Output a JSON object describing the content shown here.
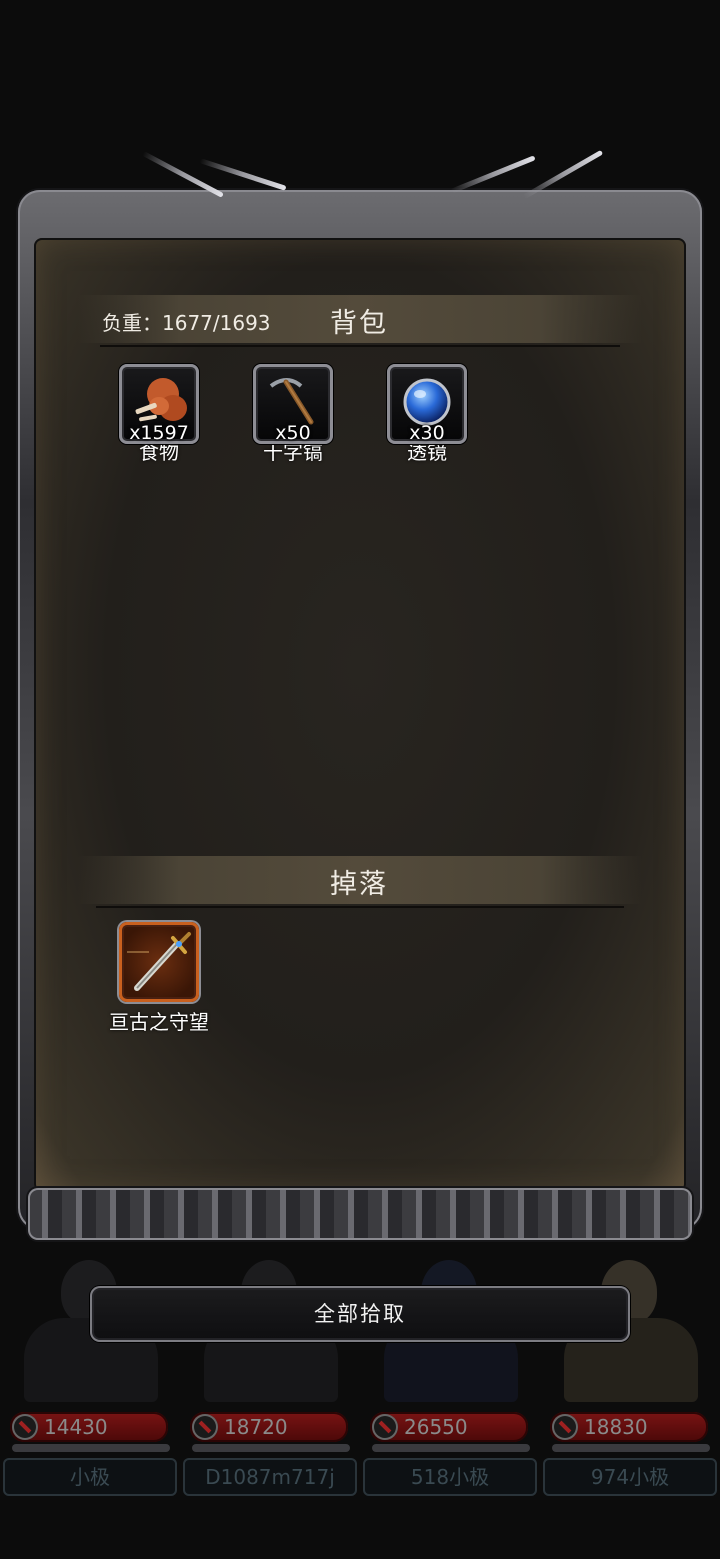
{
  "inventory": {
    "weight_label": "负重：1677/1693",
    "title": "背包",
    "items": [
      {
        "name": "食物",
        "qty": "x1597",
        "icon": "food-icon"
      },
      {
        "name": "十字镐",
        "qty": "x50",
        "icon": "pickaxe-icon"
      },
      {
        "name": "透镜",
        "qty": "x30",
        "icon": "lens-icon"
      }
    ]
  },
  "loot": {
    "title": "掉落",
    "items": [
      {
        "name": "亘古之守望",
        "icon": "sword-icon"
      }
    ]
  },
  "pickup_all_label": "全部拾取",
  "party": [
    {
      "hp": "14430",
      "name": "小极"
    },
    {
      "hp": "18720",
      "name": "D1087m717j"
    },
    {
      "hp": "26550",
      "name": "518小极"
    },
    {
      "hp": "18830",
      "name": "974小极"
    }
  ]
}
